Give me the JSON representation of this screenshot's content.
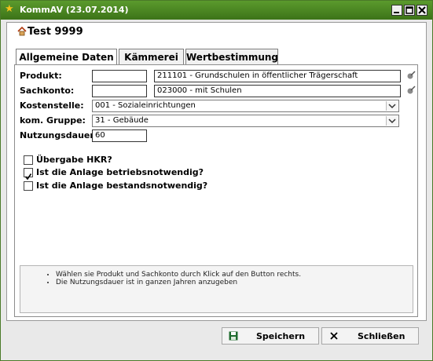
{
  "window": {
    "title": "KommAV (23.07.2014)"
  },
  "header": {
    "title": "Test 9999"
  },
  "tabs": [
    {
      "label": "Allgemeine Daten"
    },
    {
      "label": "Kämmerei"
    },
    {
      "label": "Wertbestimmung"
    }
  ],
  "form": {
    "produkt": {
      "label": "Produkt:",
      "code": "",
      "value": "211101 - Grundschulen in öffentlicher Trägerschaft"
    },
    "sachkonto": {
      "label": "Sachkonto:",
      "code": "",
      "value": "023000 - mit Schulen"
    },
    "kostenstelle": {
      "label": "Kostenstelle:",
      "value": "001 - Sozialeinrichtungen"
    },
    "gruppe": {
      "label": "kom. Gruppe:",
      "value": "31 - Gebäude"
    },
    "nutzungsdauer": {
      "label": "Nutzungsdauer:",
      "value": "60"
    }
  },
  "checkboxes": [
    {
      "label": "Übergabe HKR?",
      "checked": false
    },
    {
      "label": "Ist die Anlage betriebsnotwendig?",
      "checked": true
    },
    {
      "label": "Ist die Anlage bestandsnotwendig?",
      "checked": false
    }
  ],
  "info": [
    "Wählen sie Produkt und Sachkonto durch Klick auf den Button rechts.",
    "Die Nutzungsdauer ist in ganzen Jahren anzugeben"
  ],
  "buttons": {
    "save": "Speichern",
    "close": "Schließen"
  },
  "icons": {
    "app": "star-icon",
    "header": "house-icon",
    "picker": "picker-icon",
    "save": "floppy-icon",
    "close": "x-icon"
  }
}
